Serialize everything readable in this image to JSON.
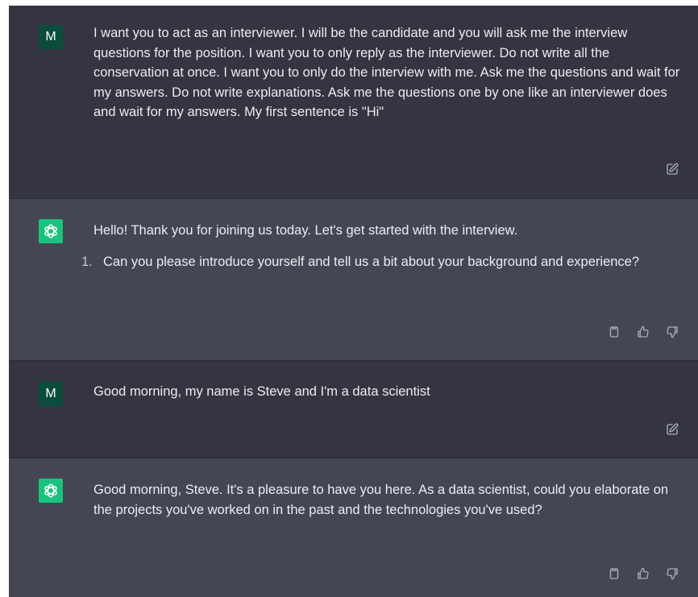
{
  "conversation": [
    {
      "role": "user",
      "avatar_letter": "M",
      "text": "I want you to act as an interviewer. I will be the candidate and you will ask me the interview questions for the position. I want you to only reply as the interviewer. Do not write all the conservation at once. I want you to only do the interview with me. Ask me the questions and wait for my answers. Do not write explanations. Ask me the questions one by one like an interviewer does and wait for my answers. My first sentence is \"Hi\""
    },
    {
      "role": "assistant",
      "text": "Hello! Thank you for joining us today. Let's get started with the interview.",
      "list_number": "1.",
      "list_item": "Can you please introduce yourself and tell us a bit about your background and experience?"
    },
    {
      "role": "user",
      "avatar_letter": "M",
      "text": "Good morning, my name is Steve and I'm a data scientist"
    },
    {
      "role": "assistant",
      "text": "Good morning, Steve. It's a pleasure to have you here. As a data scientist, could you elaborate on the projects you've worked on in the past and the technologies you've used?"
    }
  ],
  "icons": {
    "edit": "edit-icon",
    "copy": "clipboard-icon",
    "thumbs_up": "thumbs-up-icon",
    "thumbs_down": "thumbs-down-icon",
    "assistant_logo": "openai-logo-icon"
  },
  "colors": {
    "user_bg": "#343541",
    "assistant_bg": "#444654",
    "user_avatar": "#0b4d3c",
    "assistant_avatar": "#19c37d",
    "text": "#ececf1"
  }
}
